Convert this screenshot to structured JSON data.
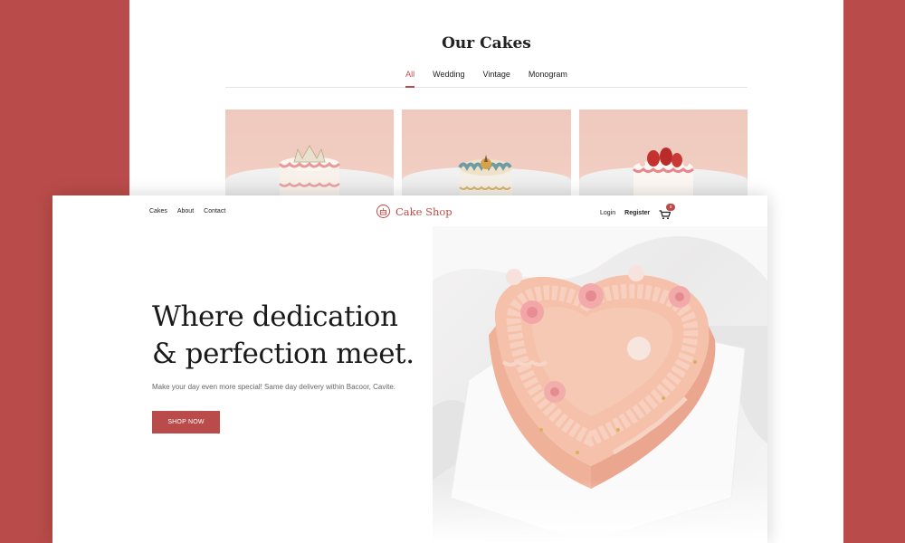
{
  "back": {
    "title": "Our Cakes",
    "tabs": [
      "All",
      "Wedding",
      "Vintage",
      "Monogram"
    ]
  },
  "nav": {
    "links": [
      "Cakes",
      "About",
      "Contact"
    ],
    "brand": "Cake Shop",
    "login": "Login",
    "register": "Register",
    "cart_count": "0"
  },
  "hero": {
    "title_line1": "Where dedication",
    "title_line2": "& perfection meet.",
    "subtitle": "Make your day even more special! Same day delivery within Bacoor, Cavite.",
    "button": "SHOP NOW"
  },
  "colors": {
    "accent": "#b94c4a",
    "background": "#b94c4a"
  }
}
